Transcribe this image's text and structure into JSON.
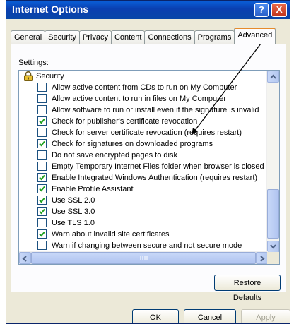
{
  "window": {
    "title": "Internet Options",
    "help_glyph": "?",
    "close_glyph": "X"
  },
  "tabs": [
    {
      "label": "General",
      "active": false
    },
    {
      "label": "Security",
      "active": false
    },
    {
      "label": "Privacy",
      "active": false
    },
    {
      "label": "Content",
      "active": false
    },
    {
      "label": "Connections",
      "active": false
    },
    {
      "label": "Programs",
      "active": false
    },
    {
      "label": "Advanced",
      "active": true
    }
  ],
  "settings": {
    "label": "Settings:",
    "category": {
      "label": "Security",
      "icon": "lock-icon"
    },
    "items": [
      {
        "label": "Allow active content from CDs to run on My Computer",
        "checked": false
      },
      {
        "label": "Allow active content to run in files on My Computer",
        "checked": false
      },
      {
        "label": "Allow software to run or install even if the signature is invalid",
        "checked": false
      },
      {
        "label": "Check for publisher's certificate revocation",
        "checked": true
      },
      {
        "label": "Check for server certificate revocation (requires restart)",
        "checked": false
      },
      {
        "label": "Check for signatures on downloaded programs",
        "checked": true
      },
      {
        "label": "Do not save encrypted pages to disk",
        "checked": false
      },
      {
        "label": "Empty Temporary Internet Files folder when browser is closed",
        "checked": false
      },
      {
        "label": "Enable Integrated Windows Authentication (requires restart)",
        "checked": true
      },
      {
        "label": "Enable Profile Assistant",
        "checked": true
      },
      {
        "label": "Use SSL 2.0",
        "checked": true
      },
      {
        "label": "Use SSL 3.0",
        "checked": true
      },
      {
        "label": "Use TLS 1.0",
        "checked": false
      },
      {
        "label": "Warn about invalid site certificates",
        "checked": true
      },
      {
        "label": "Warn if changing between secure and not secure mode",
        "checked": false
      }
    ]
  },
  "buttons": {
    "restore_defaults": "Restore Defaults",
    "ok": "OK",
    "cancel": "Cancel",
    "apply": "Apply"
  },
  "colors": {
    "titlebar": "#0a4fc4",
    "dialog_bg": "#ece9d8",
    "check_mark": "#21a121",
    "active_tab_accent": "#e68b2c",
    "annotation_arrow": "#000000"
  }
}
